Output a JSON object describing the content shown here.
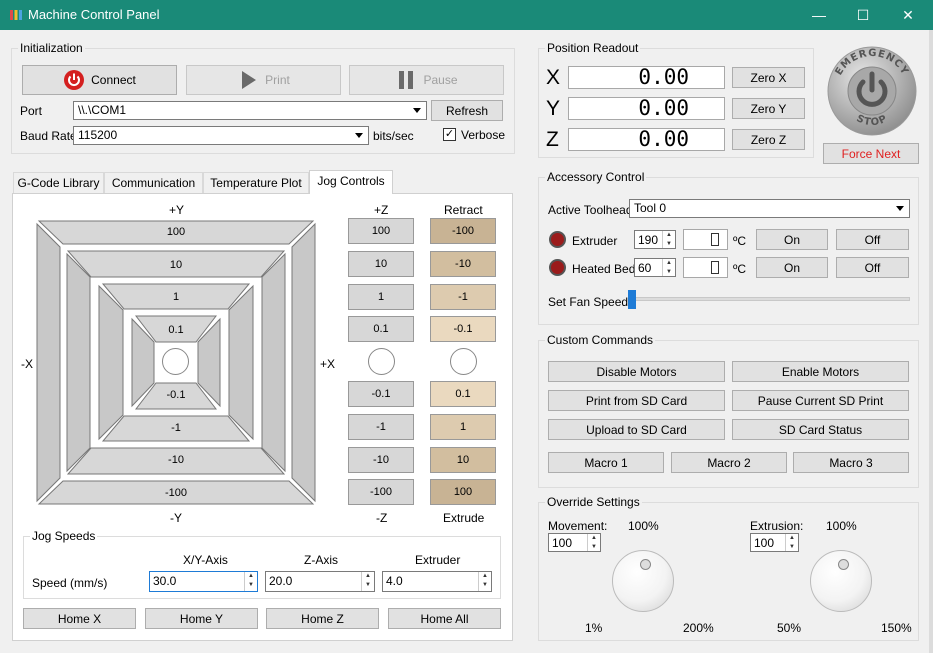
{
  "window": {
    "title": "Machine Control Panel",
    "minimize_glyph": "—",
    "maximize_glyph": "☐",
    "close_glyph": "✕"
  },
  "init": {
    "title": "Initialization",
    "connect": "Connect",
    "print": "Print",
    "pause": "Pause",
    "port_label": "Port",
    "port_value": "\\\\.\\COM1",
    "refresh": "Refresh",
    "baud_label": "Baud Rate",
    "baud_value": "115200",
    "bits_label": "bits/sec",
    "verbose": "Verbose",
    "verbose_checked": true
  },
  "tabs": [
    "G-Code Library",
    "Communication",
    "Temperature Plot",
    "Jog Controls"
  ],
  "jog": {
    "plus_y": "+Y",
    "minus_y": "-Y",
    "minus_x": "-X",
    "plus_x": "+X",
    "y_pos": [
      "100",
      "10",
      "1",
      "0.1"
    ],
    "y_neg": [
      "-0.1",
      "-1",
      "-10",
      "-100"
    ],
    "plus_z": "+Z",
    "minus_z": "-Z",
    "retract": "Retract",
    "extrude": "Extrude",
    "z_pos": [
      "100",
      "10",
      "1",
      "0.1"
    ],
    "z_neg": [
      "-0.1",
      "-1",
      "-10",
      "-100"
    ],
    "e_top": [
      "-100",
      "-10",
      "-1",
      "-0.1"
    ],
    "e_bottom": [
      "0.1",
      "1",
      "10",
      "100"
    ]
  },
  "speeds": {
    "title": "Jog Speeds",
    "col_xy": "X/Y-Axis",
    "col_z": "Z-Axis",
    "col_e": "Extruder",
    "row_label": "Speed (mm/s)",
    "xy": "30.0",
    "z": "20.0",
    "e": "4.0"
  },
  "home": {
    "x": "Home X",
    "y": "Home Y",
    "z": "Home Z",
    "all": "Home All"
  },
  "position": {
    "title": "Position Readout",
    "x_label": "X",
    "y_label": "Y",
    "z_label": "Z",
    "x_value": "0.00",
    "y_value": "0.00",
    "z_value": "0.00",
    "zero_x": "Zero X",
    "zero_y": "Zero Y",
    "zero_z": "Zero Z"
  },
  "estop": {
    "top": "EMERGENCY",
    "bottom": "STOP",
    "force_next": "Force Next"
  },
  "accessory": {
    "title": "Accessory Control",
    "toolhead_label": "Active Toolhead",
    "toolhead_value": "Tool 0",
    "extruder_label": "Extruder",
    "extruder_temp": "190",
    "bed_label": "Heated Bed",
    "bed_temp": "60",
    "unit": "ºC",
    "on": "On",
    "off": "Off",
    "fan_label": "Set Fan Speed",
    "fan_level": 0
  },
  "custom": {
    "title": "Custom Commands",
    "disable": "Disable Motors",
    "enable": "Enable Motors",
    "print_sd": "Print from SD Card",
    "pause_sd": "Pause Current SD Print",
    "upload_sd": "Upload to SD Card",
    "sd_status": "SD Card Status",
    "macro1": "Macro 1",
    "macro2": "Macro 2",
    "macro3": "Macro 3"
  },
  "override": {
    "title": "Override Settings",
    "movement_label": "Movement:",
    "movement_value": "100",
    "movement_top": "100%",
    "movement_min": "1%",
    "movement_max": "200%",
    "extrusion_label": "Extrusion:",
    "extrusion_value": "100",
    "extrusion_top": "100%",
    "extrusion_min": "50%",
    "extrusion_max": "150%"
  },
  "colors": {
    "titlebar": "#1a8a78",
    "z_button": "#d7d7d7",
    "e_button": "#dccbb0",
    "force_next": "#e02020",
    "fan_slider": "#1e7bd6"
  }
}
